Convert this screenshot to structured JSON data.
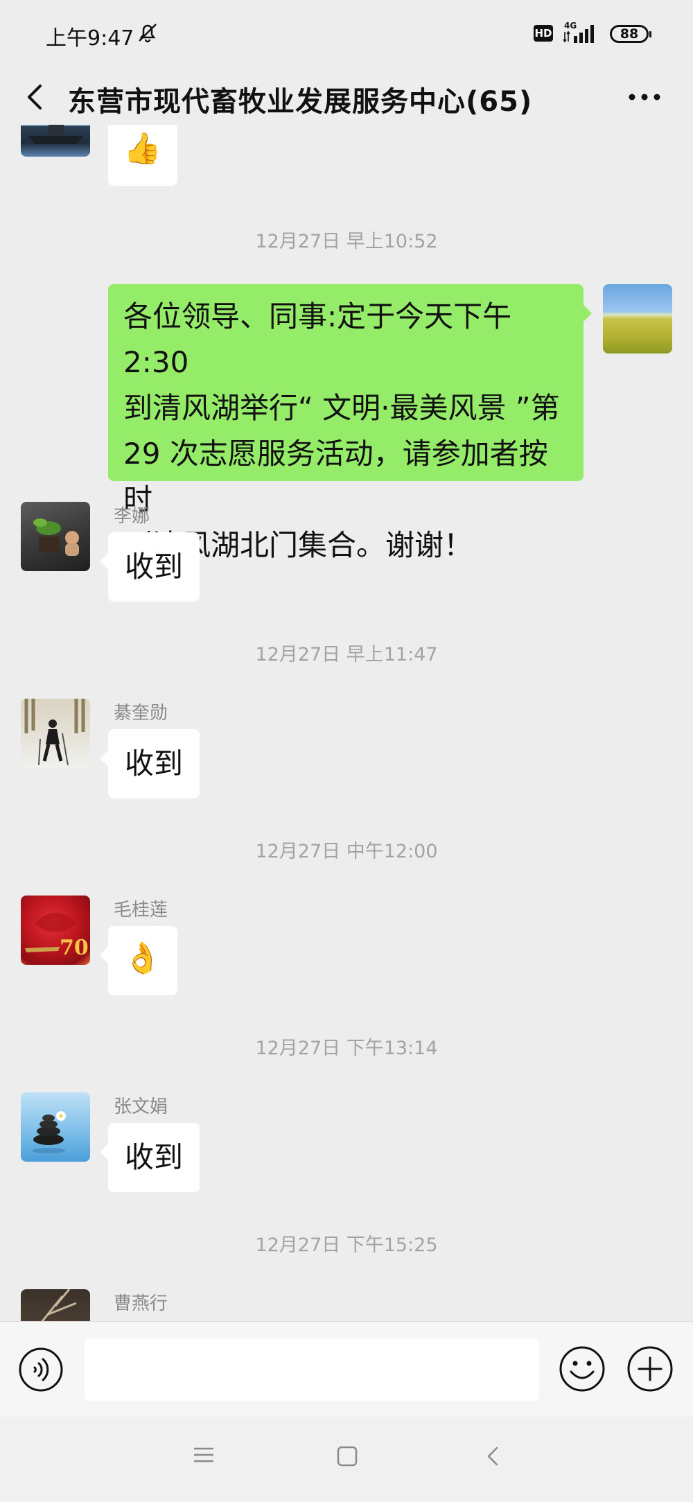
{
  "status_bar": {
    "time": "上午9:47",
    "network": "4G",
    "hd_label": "HD",
    "battery": "88"
  },
  "nav": {
    "title": "东营市现代畜牧业发展服务中心(65)"
  },
  "messages": {
    "m0": {
      "type": "emoji",
      "emoji": "👍"
    },
    "ts1": "12月27日 早上10:52",
    "m1": {
      "side": "right",
      "text": "各位领导、同事:定于今天下午 2:30 到清风湖举行“ 文明·最美风景 ”第29 次志愿服务活动，请参加者按时到清风湖北门集合。谢谢！",
      "lines": [
        "各位领导、同事:定于今天下午 2:30",
        "到清风湖举行“ 文明·最美风景 ”第",
        "29 次志愿服务活动，请参加者按时",
        "到清风湖北门集合。谢谢！"
      ]
    },
    "m2": {
      "sender": "李娜",
      "text": "收到"
    },
    "ts2": "12月27日 早上11:47",
    "m3": {
      "sender": "綦奎勋",
      "text": "收到"
    },
    "ts3": "12月27日 中午12:00",
    "m4": {
      "sender": "毛桂莲",
      "emoji": "👌"
    },
    "ts4": "12月27日 下午13:14",
    "m5": {
      "sender": "张文娟",
      "text": "收到"
    },
    "ts5": "12月27日 下午15:25",
    "m6": {
      "sender": "曹燕行"
    }
  },
  "avatar_badge_text": "70",
  "colors": {
    "background": "#ededed",
    "my_bubble": "#95ec69",
    "other_bubble": "#ffffff",
    "timestamp": "#a3a3a3"
  },
  "icons": {
    "back": "chevron-left-icon",
    "more": "more-dots-icon",
    "voice": "voice-icon",
    "emoji": "emoji-icon",
    "plus": "plus-icon",
    "mute": "bell-off-icon"
  }
}
